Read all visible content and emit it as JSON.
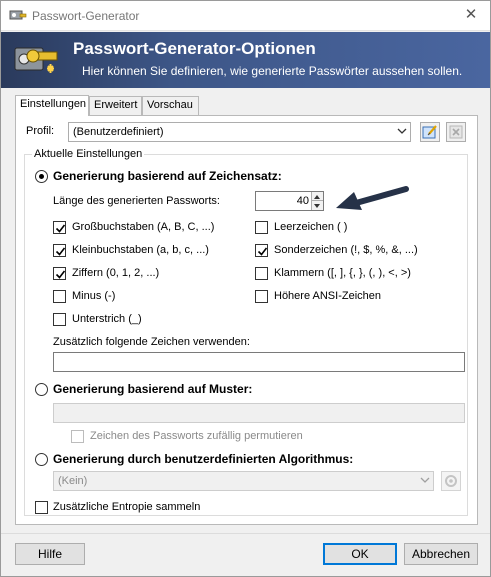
{
  "window": {
    "title": "Passwort-Generator"
  },
  "banner": {
    "title": "Passwort-Generator-Optionen",
    "subtitle": "Hier können Sie definieren, wie generierte Passwörter aussehen sollen."
  },
  "tabs": [
    {
      "label": "Einstellungen",
      "active": true
    },
    {
      "label": "Erweitert",
      "active": false
    },
    {
      "label": "Vorschau",
      "active": false
    }
  ],
  "profile": {
    "label": "Profil:",
    "value": "(Benutzerdefiniert)"
  },
  "current_settings": {
    "group_title": "Aktuelle Einstellungen",
    "charset_mode": {
      "label": "Generierung basierend auf Zeichensatz:",
      "selected": true
    },
    "length": {
      "label": "Länge des generierten Passworts:",
      "value": "40"
    },
    "charsets_left": [
      {
        "label": "Großbuchstaben (A, B, C, ...)",
        "checked": true
      },
      {
        "label": "Kleinbuchstaben (a, b, c, ...)",
        "checked": true
      },
      {
        "label": "Ziffern (0, 1, 2, ...)",
        "checked": true
      },
      {
        "label": "Minus (-)",
        "checked": false
      },
      {
        "label": "Unterstrich (_)",
        "checked": false
      }
    ],
    "charsets_right": [
      {
        "label": "Leerzeichen ( )",
        "checked": false
      },
      {
        "label": "Sonderzeichen (!, $, %, &, ...)",
        "checked": true
      },
      {
        "label": "Klammern ([, ], {, }, (, ), <, >)",
        "checked": false
      },
      {
        "label": "Höhere ANSI-Zeichen",
        "checked": false
      }
    ],
    "additional_chars": {
      "label": "Zusätzlich folgende Zeichen verwenden:",
      "value": ""
    },
    "pattern_mode": {
      "label": "Generierung basierend auf Muster:",
      "selected": false,
      "value": "",
      "permute_label": "Zeichen des Passworts zufällig permutieren",
      "permute_checked": false
    },
    "custom_mode": {
      "label": "Generierung durch benutzerdefinierten Algorithmus:",
      "selected": false,
      "value": "(Kein)"
    },
    "entropy": {
      "label": "Zusätzliche Entropie sammeln",
      "checked": false
    }
  },
  "buttons": {
    "help": "Hilfe",
    "ok": "OK",
    "cancel": "Abbrechen"
  },
  "colors": {
    "banner_dark": "#2a3a5c",
    "banner_light": "#4a66a0",
    "default_button_border": "#0078d7",
    "arrow_annotation": "#263248"
  }
}
